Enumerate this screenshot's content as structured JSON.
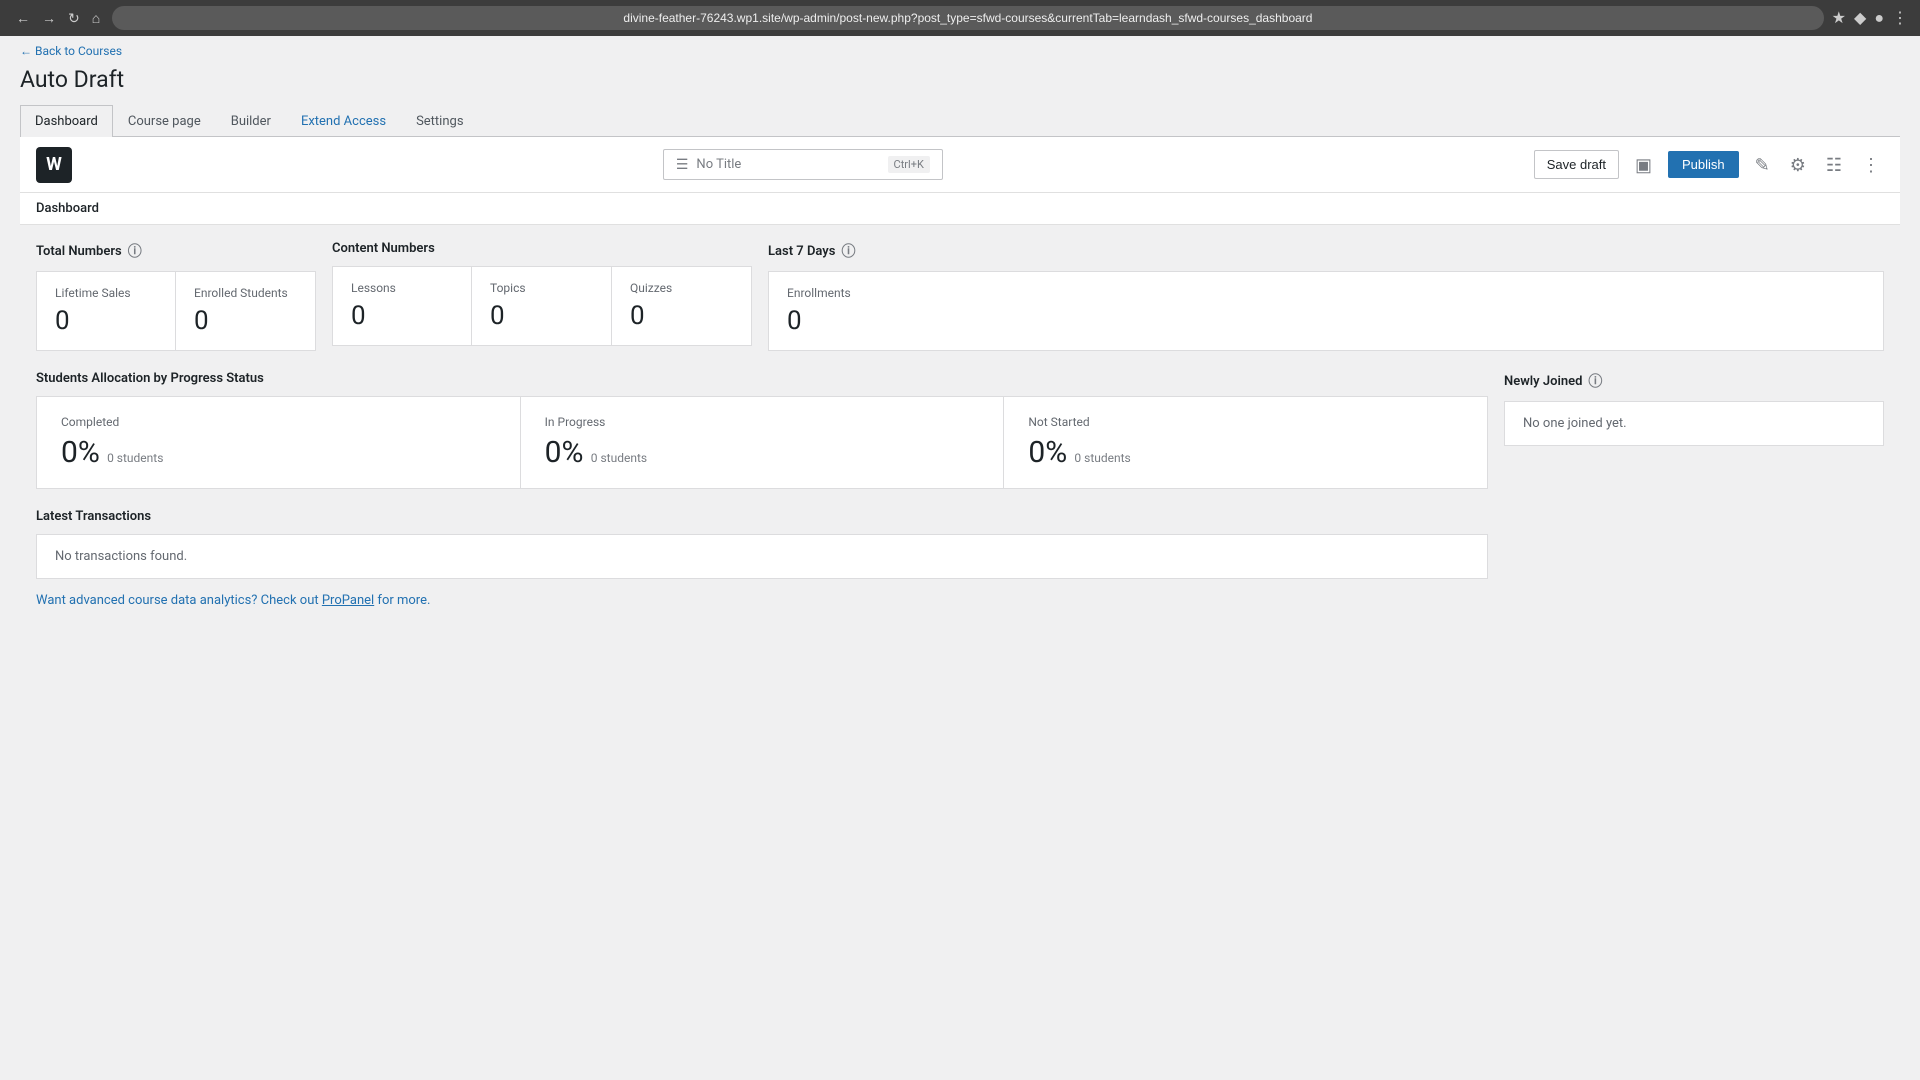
{
  "browser": {
    "url": "divine-feather-76243.wp1.site/wp-admin/post-new.php?post_type=sfwd-courses&currentTab=learndash_sfwd-courses_dashboard",
    "back_title": "← Back to Courses"
  },
  "page": {
    "title": "Auto Draft"
  },
  "tabs": [
    {
      "label": "Dashboard",
      "active": true,
      "special": false
    },
    {
      "label": "Course page",
      "active": false,
      "special": false
    },
    {
      "label": "Builder",
      "active": false,
      "special": false
    },
    {
      "label": "Extend Access",
      "active": false,
      "special": true
    },
    {
      "label": "Settings",
      "active": false,
      "special": false
    }
  ],
  "toolbar": {
    "title_placeholder": "No Title",
    "shortcut": "Ctrl+K",
    "save_draft_label": "Save draft",
    "publish_label": "Publish"
  },
  "dashboard": {
    "section_label": "Dashboard",
    "total_numbers": {
      "title": "Total Numbers",
      "cards": [
        {
          "label": "Lifetime Sales",
          "value": "0"
        },
        {
          "label": "Enrolled Students",
          "value": "0"
        }
      ]
    },
    "content_numbers": {
      "title": "Content Numbers",
      "cards": [
        {
          "label": "Lessons",
          "value": "0"
        },
        {
          "label": "Topics",
          "value": "0"
        },
        {
          "label": "Quizzes",
          "value": "0"
        }
      ]
    },
    "last_7_days": {
      "title": "Last 7 Days",
      "cards": [
        {
          "label": "Enrollments",
          "value": "0"
        }
      ]
    },
    "progress": {
      "title": "Students Allocation by Progress Status",
      "items": [
        {
          "label": "Completed",
          "value": "0%",
          "students": "0 students"
        },
        {
          "label": "In Progress",
          "value": "0%",
          "students": "0 students"
        },
        {
          "label": "Not Started",
          "value": "0%",
          "students": "0 students"
        }
      ]
    },
    "newly_joined": {
      "title": "Newly Joined",
      "empty_message": "No one joined yet."
    },
    "transactions": {
      "title": "Latest Transactions",
      "empty_message": "No transactions found."
    },
    "analytics": {
      "text": "Want advanced course data analytics? Check out ProPanel for more."
    }
  }
}
